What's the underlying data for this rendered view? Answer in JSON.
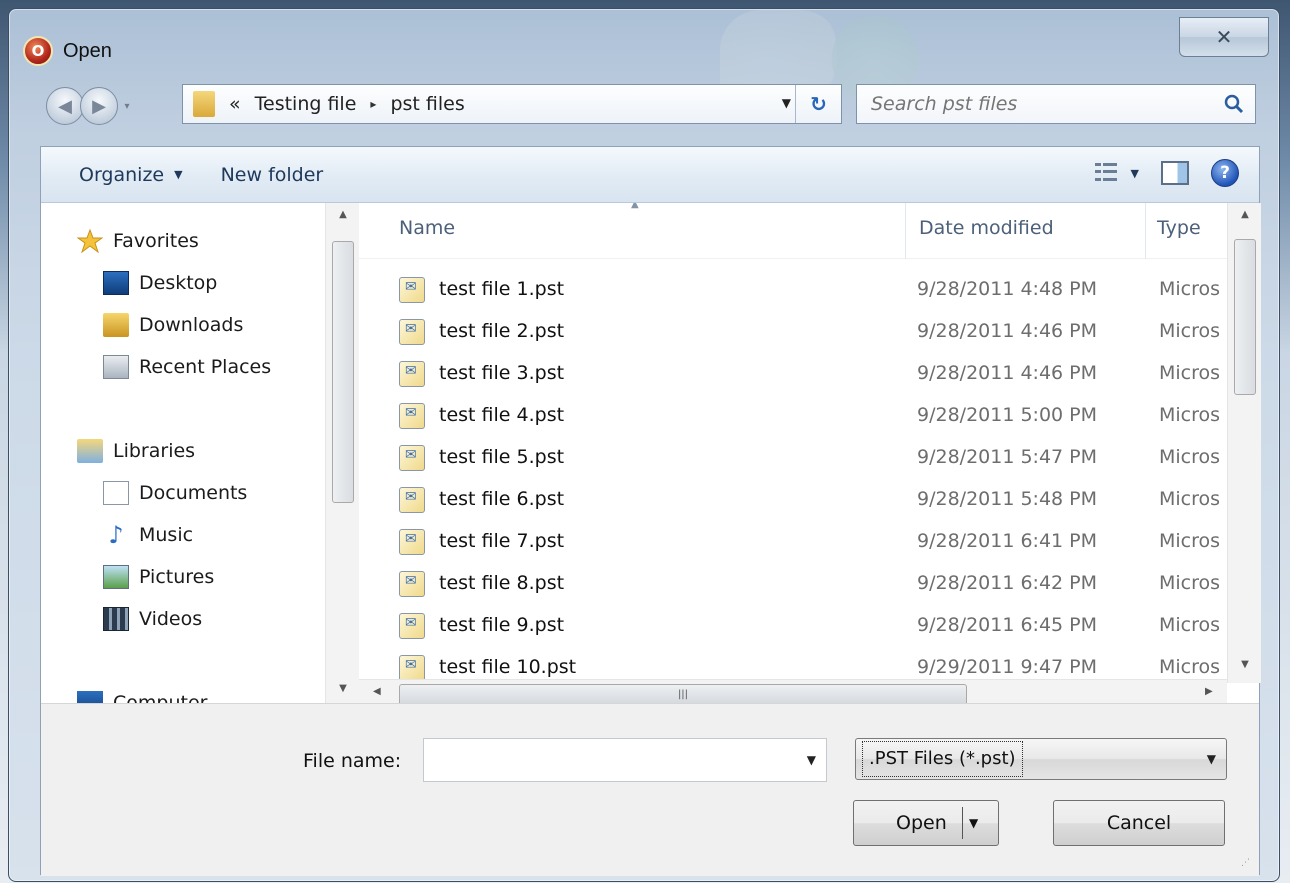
{
  "window": {
    "title": "Open",
    "close_glyph": "✕"
  },
  "nav": {
    "back_glyph": "◀",
    "forward_glyph": "▶",
    "recent_glyph": "▾"
  },
  "address": {
    "overflow": "«",
    "crumbs": [
      "Testing file",
      "pst files"
    ],
    "separator": "▸",
    "dropdown_glyph": "▼",
    "refresh_glyph": "↻"
  },
  "search": {
    "placeholder": "Search pst files"
  },
  "toolbar": {
    "organize_label": "Organize",
    "new_folder_label": "New folder",
    "caret": "▼"
  },
  "sidebar": {
    "favorites": {
      "label": "Favorites",
      "icon": "star-icon"
    },
    "favorite_items": [
      {
        "label": "Desktop",
        "icon": "desktop-icon"
      },
      {
        "label": "Downloads",
        "icon": "downloads-icon"
      },
      {
        "label": "Recent Places",
        "icon": "recent-places-icon"
      }
    ],
    "libraries": {
      "label": "Libraries",
      "icon": "libraries-icon"
    },
    "library_items": [
      {
        "label": "Documents",
        "icon": "documents-icon"
      },
      {
        "label": "Music",
        "icon": "music-icon"
      },
      {
        "label": "Pictures",
        "icon": "pictures-icon"
      },
      {
        "label": "Videos",
        "icon": "videos-icon"
      }
    ],
    "computer": {
      "label": "Computer",
      "icon": "computer-icon"
    }
  },
  "filelist": {
    "columns": [
      "Name",
      "Date modified",
      "Type"
    ],
    "rows": [
      {
        "name": "test file 1.pst",
        "date": "9/28/2011 4:48 PM",
        "type": "Micros"
      },
      {
        "name": "test file 2.pst",
        "date": "9/28/2011 4:46 PM",
        "type": "Micros"
      },
      {
        "name": "test file 3.pst",
        "date": "9/28/2011 4:46 PM",
        "type": "Micros"
      },
      {
        "name": "test file 4.pst",
        "date": "9/28/2011 5:00 PM",
        "type": "Micros"
      },
      {
        "name": "test file 5.pst",
        "date": "9/28/2011 5:47 PM",
        "type": "Micros"
      },
      {
        "name": "test file 6.pst",
        "date": "9/28/2011 5:48 PM",
        "type": "Micros"
      },
      {
        "name": "test file 7.pst",
        "date": "9/28/2011 6:41 PM",
        "type": "Micros"
      },
      {
        "name": "test file 8.pst",
        "date": "9/28/2011 6:42 PM",
        "type": "Micros"
      },
      {
        "name": "test file 9.pst",
        "date": "9/28/2011 6:45 PM",
        "type": "Micros"
      },
      {
        "name": "test file 10.pst",
        "date": "9/29/2011 9:47 PM",
        "type": "Micros"
      }
    ]
  },
  "bottom": {
    "file_name_label": "File name:",
    "file_name_value": "",
    "file_type_value": ".PST Files (*.pst)",
    "open_label": "Open",
    "cancel_label": "Cancel"
  }
}
